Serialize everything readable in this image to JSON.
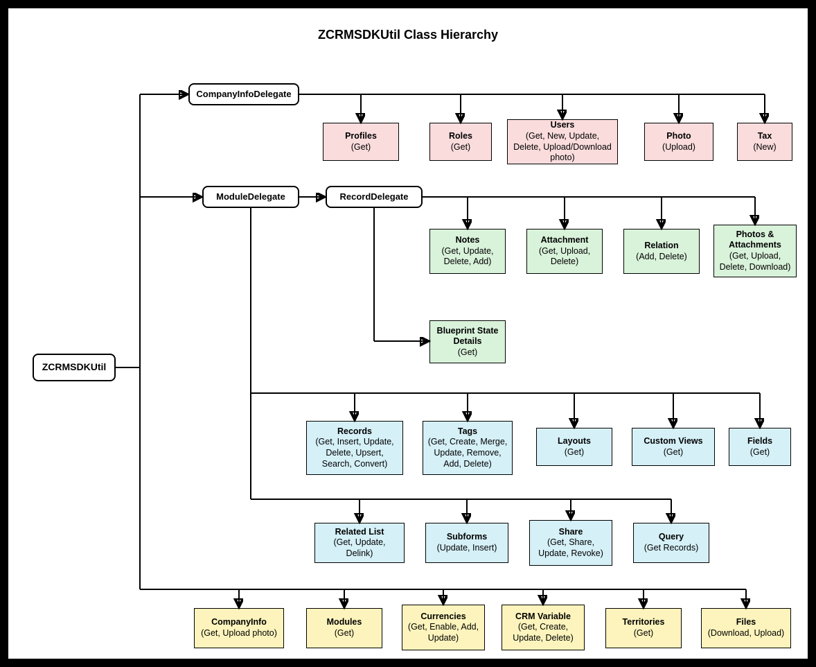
{
  "title": "ZCRMSDKUtil Class Hierarchy",
  "root": {
    "label": "ZCRMSDKUtil"
  },
  "delegates": {
    "company": "CompanyInfoDelegate",
    "module": "ModuleDelegate",
    "record": "RecordDelegate"
  },
  "company_children": [
    {
      "t": "Profiles",
      "s": "(Get)"
    },
    {
      "t": "Roles",
      "s": "(Get)"
    },
    {
      "t": "Users",
      "s": "(Get, New, Update, Delete, Upload/Download photo)"
    },
    {
      "t": "Photo",
      "s": "(Upload)"
    },
    {
      "t": "Tax",
      "s": "(New)"
    }
  ],
  "record_children_row1": [
    {
      "t": "Notes",
      "s": "(Get, Update, Delete, Add)"
    },
    {
      "t": "Attachment",
      "s": "(Get, Upload, Delete)"
    },
    {
      "t": "Relation",
      "s": "(Add, Delete)"
    },
    {
      "t": "Photos & Attachments",
      "s": "(Get, Upload, Delete, Download)"
    }
  ],
  "record_blueprint": {
    "t": "Blueprint State Details",
    "s": "(Get)"
  },
  "module_children_row1": [
    {
      "t": "Records",
      "s": "(Get, Insert, Update, Delete, Upsert, Search, Convert)"
    },
    {
      "t": "Tags",
      "s": "(Get, Create, Merge, Update, Remove, Add, Delete)"
    },
    {
      "t": "Layouts",
      "s": "(Get)"
    },
    {
      "t": "Custom Views",
      "s": "(Get)"
    },
    {
      "t": "Fields",
      "s": "(Get)"
    }
  ],
  "module_children_row2": [
    {
      "t": "Related List",
      "s": "(Get, Update, Delink)"
    },
    {
      "t": "Subforms",
      "s": "(Update, Insert)"
    },
    {
      "t": "Share",
      "s": "(Get, Share, Update, Revoke)"
    },
    {
      "t": "Query",
      "s": "(Get Records)"
    }
  ],
  "util_children": [
    {
      "t": "CompanyInfo",
      "s": "(Get, Upload photo)"
    },
    {
      "t": "Modules",
      "s": "(Get)"
    },
    {
      "t": "Currencies",
      "s": "(Get, Enable, Add, Update)"
    },
    {
      "t": "CRM Variable",
      "s": "(Get, Create, Update, Delete)"
    },
    {
      "t": "Territories",
      "s": "(Get)"
    },
    {
      "t": "Files",
      "s": "(Download, Upload)"
    }
  ]
}
